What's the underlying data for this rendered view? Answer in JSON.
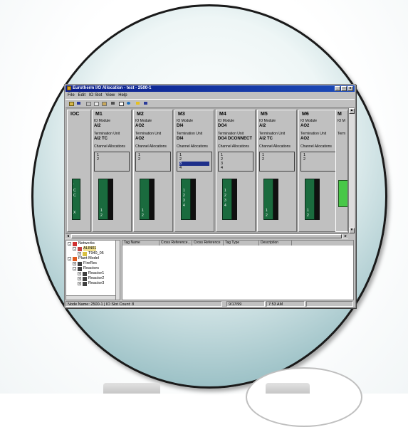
{
  "window": {
    "title": "Eurotherm I/O Allocation - test - 2500-1",
    "controls": [
      "_",
      "□",
      "x"
    ]
  },
  "menu": [
    "File",
    "Edit",
    "IO Slot",
    "View",
    "Help"
  ],
  "toolbar": [
    "open-icon",
    "save-icon",
    "cut-icon",
    "copy-icon",
    "paste-icon",
    "print-icon",
    "preview-icon",
    "globe-icon",
    "help-icon",
    "context-help-icon"
  ],
  "slots": [
    {
      "name": "IOC",
      "type": "ioc",
      "hw_labels": [
        "",
        ".",
        "C",
        "C",
        "",
        "",
        "X"
      ]
    },
    {
      "name": "M1",
      "module_label": "IO Module",
      "module": "AI2",
      "term_label": "Termination Unit",
      "term": "AI2 TC",
      "alloc_label": "Channel Allocations",
      "channels": [
        "1",
        "2"
      ],
      "selected": -1,
      "hw_labels": [
        "1",
        "2"
      ]
    },
    {
      "name": "M2",
      "module_label": "IO Module",
      "module": "AO2",
      "term_label": "Termination Unit",
      "term": "AO2",
      "alloc_label": "Channel Allocations",
      "channels": [
        "1",
        "2"
      ],
      "selected": -1,
      "hw_labels": [
        "1",
        "2"
      ]
    },
    {
      "name": "M3",
      "module_label": "IO Module",
      "module": "DI4",
      "term_label": "Termination Unit",
      "term": "DI4",
      "alloc_label": "Channel Allocations",
      "channels": [
        "1",
        "2",
        "3",
        "4"
      ],
      "selected": 2,
      "hw_labels": [
        "1",
        "2",
        "3",
        "4"
      ]
    },
    {
      "name": "M4",
      "module_label": "IO Module",
      "module": "DO4",
      "term_label": "Termination Unit",
      "term": "DO4 DCONNECT",
      "alloc_label": "Channel Allocations",
      "channels": [
        "1",
        "2",
        "3",
        "4"
      ],
      "selected": -1,
      "hw_labels": [
        "1",
        "2",
        "3",
        "4"
      ]
    },
    {
      "name": "M5",
      "module_label": "IO Module",
      "module": "AI2",
      "term_label": "Termination Unit",
      "term": "AI2 TC",
      "alloc_label": "Channel Allocations",
      "channels": [
        "1",
        "2"
      ],
      "selected": -1,
      "hw_labels": [
        "1",
        "2"
      ]
    },
    {
      "name": "M6",
      "module_label": "IO Module",
      "module": "AO2",
      "term_label": "Termination Unit",
      "term": "AO2",
      "alloc_label": "Channel Allocations",
      "channels": [
        "1",
        "2"
      ],
      "selected": -1,
      "hw_labels": [
        "1",
        "2"
      ]
    }
  ],
  "partial_slot": {
    "name": "M",
    "module_label": "IO M",
    "term_label": "Term"
  },
  "tree": [
    {
      "label": "Networks",
      "indent": 0,
      "expander": "-",
      "icon": "network"
    },
    {
      "label": "ALIN01",
      "indent": 1,
      "expander": "-",
      "icon": "alin",
      "highlight": true
    },
    {
      "label": "T940_05",
      "indent": 2,
      "expander": "+",
      "icon": "node"
    },
    {
      "label": "Plant Model",
      "indent": 0,
      "expander": "-",
      "icon": "plant"
    },
    {
      "label": "FireRec",
      "indent": 1,
      "expander": "+",
      "icon": "folder"
    },
    {
      "label": "Reactors",
      "indent": 1,
      "expander": "-",
      "icon": "folder"
    },
    {
      "label": "Reactor1",
      "indent": 2,
      "expander": "+",
      "icon": "folder"
    },
    {
      "label": "Reactor2",
      "indent": 2,
      "expander": "+",
      "icon": "folder"
    },
    {
      "label": "Reactor3",
      "indent": 2,
      "expander": "+",
      "icon": "folder"
    }
  ],
  "table": {
    "columns": [
      "Tag Name",
      "Cross Reference...",
      "Cross Reference",
      "Tag Type",
      "Description"
    ]
  },
  "status": {
    "node": "Node Name: 2500-1",
    "slot_count": "IO Slot Count: 8",
    "date": "9/17/99",
    "time": "7:53 AM"
  }
}
